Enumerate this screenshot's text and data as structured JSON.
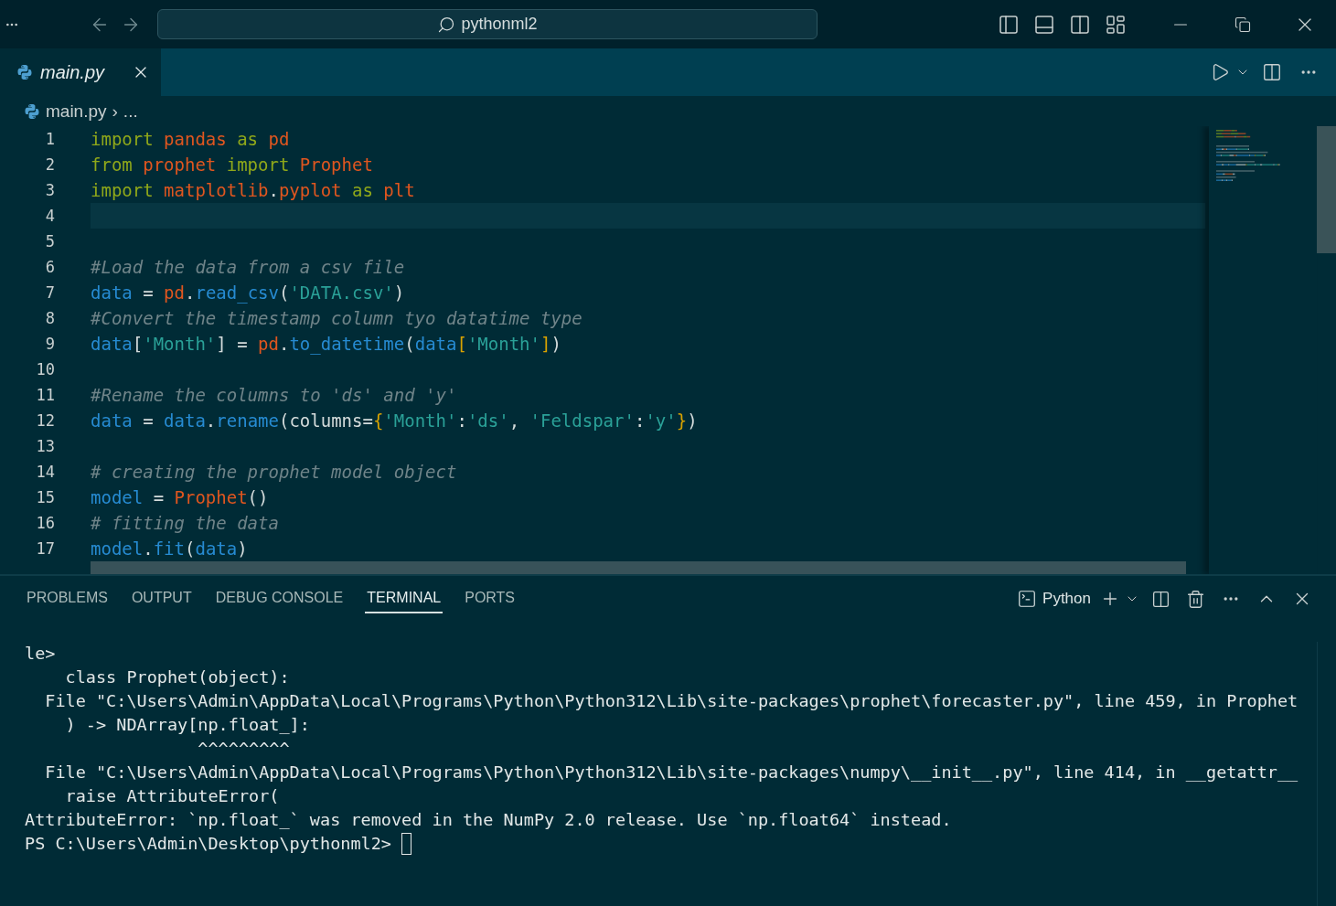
{
  "title_bar": {
    "search": "pythonml2"
  },
  "tabs": [
    {
      "label": "main.py",
      "selected": true,
      "preview": true
    }
  ],
  "breadcrumb": {
    "file": "main.py",
    "separator": "›",
    "more": "..."
  },
  "editor": {
    "lines": [
      {
        "number": "1",
        "tokens": [
          {
            "kind": "kw",
            "text": "import "
          },
          {
            "kind": "mod",
            "text": "pandas "
          },
          {
            "kind": "kw",
            "text": "as "
          },
          {
            "kind": "mod",
            "text": "pd"
          }
        ]
      },
      {
        "number": "2",
        "tokens": [
          {
            "kind": "kw",
            "text": "from "
          },
          {
            "kind": "mod",
            "text": "prophet "
          },
          {
            "kind": "kw",
            "text": "import "
          },
          {
            "kind": "mod",
            "text": "Prophet"
          }
        ]
      },
      {
        "number": "3",
        "tokens": [
          {
            "kind": "kw",
            "text": "import "
          },
          {
            "kind": "mod",
            "text": "matplotlib"
          },
          {
            "kind": "punct",
            "text": "."
          },
          {
            "kind": "mod",
            "text": "pyplot "
          },
          {
            "kind": "kw",
            "text": "as "
          },
          {
            "kind": "mod",
            "text": "plt"
          }
        ]
      },
      {
        "number": "4",
        "current": true
      },
      {
        "number": "5"
      },
      {
        "number": "6",
        "tokens": [
          {
            "kind": "cmt",
            "text": "#Load the data from a csv file"
          }
        ]
      },
      {
        "number": "7",
        "tokens": [
          {
            "kind": "name",
            "text": "data "
          },
          {
            "kind": "punct",
            "text": "= "
          },
          {
            "kind": "mod",
            "text": "pd"
          },
          {
            "kind": "punct",
            "text": "."
          },
          {
            "kind": "name",
            "text": "read_csv"
          },
          {
            "kind": "punct",
            "text": "("
          },
          {
            "kind": "str",
            "text": "'DATA.csv'"
          },
          {
            "kind": "punct",
            "text": ")"
          }
        ]
      },
      {
        "number": "8",
        "tokens": [
          {
            "kind": "cmt",
            "text": "#Convert the timestamp column tyo datatime type"
          }
        ]
      },
      {
        "number": "9",
        "tokens": [
          {
            "kind": "name",
            "text": "data"
          },
          {
            "kind": "punct",
            "text": "["
          },
          {
            "kind": "str",
            "text": "'Month'"
          },
          {
            "kind": "punct",
            "text": "] = "
          },
          {
            "kind": "mod",
            "text": "pd"
          },
          {
            "kind": "punct",
            "text": "."
          },
          {
            "kind": "name",
            "text": "to_datetime"
          },
          {
            "kind": "punct",
            "text": "("
          },
          {
            "kind": "name",
            "text": "data"
          },
          {
            "kind": "brace",
            "text": "["
          },
          {
            "kind": "str",
            "text": "'Month'"
          },
          {
            "kind": "brace",
            "text": "]"
          },
          {
            "kind": "punct",
            "text": ")"
          }
        ]
      },
      {
        "number": "10"
      },
      {
        "number": "11",
        "tokens": [
          {
            "kind": "cmt",
            "text": "#Rename the columns to 'ds' and 'y'"
          }
        ]
      },
      {
        "number": "12",
        "tokens": [
          {
            "kind": "name",
            "text": "data "
          },
          {
            "kind": "punct",
            "text": "= "
          },
          {
            "kind": "name",
            "text": "data"
          },
          {
            "kind": "punct",
            "text": "."
          },
          {
            "kind": "name",
            "text": "rename"
          },
          {
            "kind": "punct",
            "text": "(columns="
          },
          {
            "kind": "brace",
            "text": "{"
          },
          {
            "kind": "str",
            "text": "'Month'"
          },
          {
            "kind": "punct",
            "text": ":"
          },
          {
            "kind": "str",
            "text": "'ds'"
          },
          {
            "kind": "punct",
            "text": ", "
          },
          {
            "kind": "str",
            "text": "'Feldspar'"
          },
          {
            "kind": "punct",
            "text": ":"
          },
          {
            "kind": "str",
            "text": "'y'"
          },
          {
            "kind": "brace",
            "text": "}"
          },
          {
            "kind": "punct",
            "text": ")"
          }
        ]
      },
      {
        "number": "13"
      },
      {
        "number": "14",
        "tokens": [
          {
            "kind": "cmt",
            "text": "# creating the prophet model object"
          }
        ]
      },
      {
        "number": "15",
        "tokens": [
          {
            "kind": "name",
            "text": "model "
          },
          {
            "kind": "punct",
            "text": "= "
          },
          {
            "kind": "mod",
            "text": "Prophet"
          },
          {
            "kind": "punct",
            "text": "()"
          }
        ]
      },
      {
        "number": "16",
        "tokens": [
          {
            "kind": "cmt",
            "text": "# fitting the data"
          }
        ]
      },
      {
        "number": "17",
        "tokens": [
          {
            "kind": "name",
            "text": "model"
          },
          {
            "kind": "punct",
            "text": "."
          },
          {
            "kind": "name",
            "text": "fit"
          },
          {
            "kind": "punct",
            "text": "("
          },
          {
            "kind": "name",
            "text": "data"
          },
          {
            "kind": "punct",
            "text": ")"
          }
        ]
      }
    ]
  },
  "panel": {
    "tabs": [
      {
        "label": "PROBLEMS",
        "selected": false
      },
      {
        "label": "OUTPUT",
        "selected": false
      },
      {
        "label": "DEBUG CONSOLE",
        "selected": false
      },
      {
        "label": "TERMINAL",
        "selected": true
      },
      {
        "label": "PORTS",
        "selected": false
      }
    ],
    "terminal_name": "Python",
    "terminal_lines": [
      "le>",
      "    class Prophet(object):",
      "  File \"C:\\Users\\Admin\\AppData\\Local\\Programs\\Python\\Python312\\Lib\\site-packages\\prophet\\forecaster.py\", line 459, in Prophet",
      "    ) -> NDArray[np.float_]:",
      "                 ^^^^^^^^^",
      "  File \"C:\\Users\\Admin\\AppData\\Local\\Programs\\Python\\Python312\\Lib\\site-packages\\numpy\\__init__.py\", line 414, in __getattr__",
      "    raise AttributeError(",
      "AttributeError: `np.float_` was removed in the NumPy 2.0 release. Use `np.float64` instead."
    ],
    "prompt": "PS C:\\Users\\Admin\\Desktop\\pythonml2> "
  }
}
